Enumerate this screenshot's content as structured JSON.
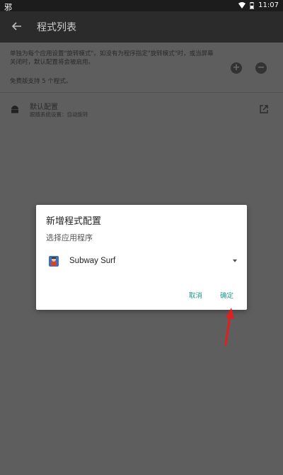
{
  "status_bar": {
    "left_label": "邪",
    "time": "11:07"
  },
  "app_bar": {
    "title": "程式列表"
  },
  "content": {
    "description": "单独为每个应用设置\"旋转模式\"。如没有为程序指定\"旋转模式\"时，或当屏幕关闭时，默认配置将会被启用。",
    "free_note": "免费版支持 5 个程式。",
    "add_label": "+",
    "remove_label": "−",
    "default_item": {
      "title": "默认配置",
      "subtitle": "跟随系统设置：自动旋转"
    }
  },
  "dialog": {
    "title": "新增程式配置",
    "subtitle": "选择应用程序",
    "selected_app": "Subway Surf",
    "cancel_label": "取消",
    "ok_label": "确定"
  },
  "colors": {
    "accent": "#1e9a8a",
    "annotation_arrow": "#e0201d"
  }
}
